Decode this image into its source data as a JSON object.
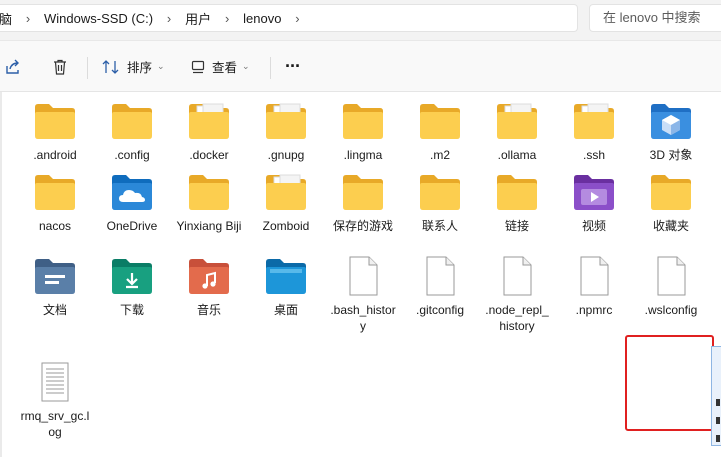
{
  "breadcrumb": {
    "segments": [
      "脑",
      "Windows-SSD (C:)",
      "用户",
      "lenovo"
    ]
  },
  "search": {
    "placeholder": "在 lenovo 中搜索"
  },
  "toolbar": {
    "share_icon": "share-icon",
    "delete_icon": "trash-icon",
    "sort_label": "排序",
    "view_label": "查看",
    "more_label": "···"
  },
  "files": [
    {
      "name": ".android",
      "icon": "folder"
    },
    {
      "name": ".config",
      "icon": "folder"
    },
    {
      "name": ".docker",
      "icon": "folder-docs"
    },
    {
      "name": ".gnupg",
      "icon": "folder-docs"
    },
    {
      "name": ".lingma",
      "icon": "folder"
    },
    {
      "name": ".m2",
      "icon": "folder"
    },
    {
      "name": ".ollama",
      "icon": "folder-docs"
    },
    {
      "name": ".ssh",
      "icon": "folder-docs"
    },
    {
      "name": "3D 对象",
      "icon": "folder-3d"
    },
    {
      "name": "nacos",
      "icon": "folder"
    },
    {
      "name": "OneDrive",
      "icon": "folder-onedrive"
    },
    {
      "name": "Yinxiang Biji",
      "icon": "folder"
    },
    {
      "name": "Zomboid",
      "icon": "folder-docs"
    },
    {
      "name": "保存的游戏",
      "icon": "folder"
    },
    {
      "name": "联系人",
      "icon": "folder"
    },
    {
      "name": "链接",
      "icon": "folder"
    },
    {
      "name": "视频",
      "icon": "folder-videos"
    },
    {
      "name": "收藏夹",
      "icon": "folder"
    },
    {
      "name": "文档",
      "icon": "folder-documents"
    },
    {
      "name": "下载",
      "icon": "folder-downloads"
    },
    {
      "name": "音乐",
      "icon": "folder-music"
    },
    {
      "name": "桌面",
      "icon": "folder-desktop"
    },
    {
      "name": ".bash_history",
      "icon": "file"
    },
    {
      "name": ".gitconfig",
      "icon": "file"
    },
    {
      "name": ".node_repl_history",
      "icon": "file"
    },
    {
      "name": ".npmrc",
      "icon": "file"
    },
    {
      "name": ".wslconfig",
      "icon": "file",
      "highlighted": true
    },
    {
      "name": "rmq_srv_gc.log",
      "icon": "file-text"
    }
  ]
}
